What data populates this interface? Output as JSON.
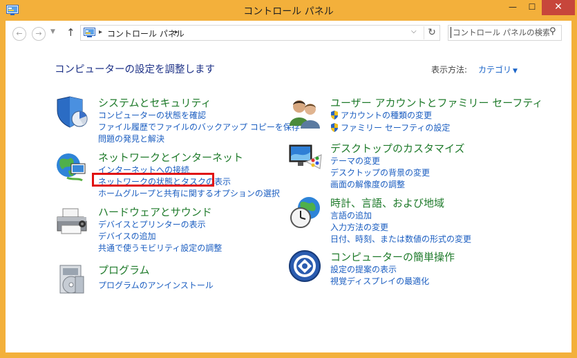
{
  "window": {
    "title": "コントロール パネル",
    "minimize_glyph": "—",
    "maximize_glyph": "☐",
    "close_glyph": "✕"
  },
  "address_bar": {
    "path_label": "コントロール パネル",
    "separator": "▸"
  },
  "search": {
    "placeholder": "コントロール パネルの検索"
  },
  "heading": "コンピューターの設定を調整します",
  "view_by": {
    "label": "表示方法:",
    "value": "カテゴリ"
  },
  "categories": {
    "system": {
      "title": "システムとセキュリティ",
      "icon": "shield-icon",
      "links": [
        "コンピューターの状態を確認",
        "ファイル履歴でファイルのバックアップ コピーを保存",
        "問題の発見と解決"
      ]
    },
    "network": {
      "title": "ネットワークとインターネット",
      "icon": "network-globe-icon",
      "links": [
        "インターネットへの接続",
        "ネットワークの状態とタスクの表示",
        "ホームグループと共有に関するオプションの選択"
      ]
    },
    "hardware": {
      "title": "ハードウェアとサウンド",
      "icon": "printer-icon",
      "links": [
        "デバイスとプリンターの表示",
        "デバイスの追加",
        "共通で使うモビリティ設定の調整"
      ]
    },
    "programs": {
      "title": "プログラム",
      "icon": "programs-disc-icon",
      "links": [
        "プログラムのアンインストール"
      ]
    },
    "users": {
      "title": "ユーザー アカウントとファミリー セーフティ",
      "icon": "users-icon",
      "links": [
        "アカウントの種類の変更",
        "ファミリー セーフティの設定"
      ]
    },
    "appearance": {
      "title": "デスクトップのカスタマイズ",
      "icon": "monitor-palette-icon",
      "links": [
        "テーマの変更",
        "デスクトップの背景の変更",
        "画面の解像度の調整"
      ]
    },
    "clock": {
      "title": "時計、言語、および地域",
      "icon": "clock-globe-icon",
      "links": [
        "言語の追加",
        "入力方法の変更",
        "日付、時刻、または数値の形式の変更"
      ]
    },
    "ease": {
      "title": "コンピューターの簡単操作",
      "icon": "ease-of-access-icon",
      "links": [
        "設定の提案の表示",
        "視覚ディスプレイの最適化"
      ]
    }
  },
  "colors": {
    "frame": "#f3b03b",
    "close_button": "#c7463b",
    "link": "#1a5dc0",
    "category_title": "#1e7a2a",
    "heading": "#1e3287",
    "highlight": "#e01010"
  }
}
